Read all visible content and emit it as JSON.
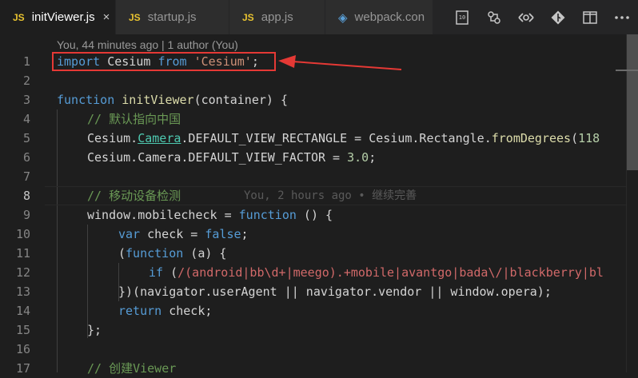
{
  "tabs": [
    {
      "icon": "JS",
      "label": "initViewer.js",
      "active": true,
      "close": "×"
    },
    {
      "icon": "JS",
      "label": "startup.js",
      "active": false
    },
    {
      "icon": "JS",
      "label": "app.js",
      "active": false
    },
    {
      "icon": "webpack",
      "label": "webpack.con",
      "active": false
    }
  ],
  "codelens": "You, 44 minutes ago | 1 author (You)",
  "blame_line8": "You, 2 hours ago • 继续完善",
  "line_numbers": [
    "1",
    "2",
    "3",
    "4",
    "5",
    "6",
    "7",
    "8",
    "9",
    "10",
    "11",
    "12",
    "13",
    "14",
    "15",
    "16",
    "17"
  ],
  "code": {
    "l1": {
      "kw1": "import",
      "id": " Cesium ",
      "kw2": "from",
      "str": "'Cesium'",
      "end": ";"
    },
    "l3": {
      "kw": "function",
      "fn": "initViewer",
      "rest": "(container) {"
    },
    "l4": {
      "cm": "// 默认指向中国"
    },
    "l5": {
      "a": "Cesium.",
      "link": "Camera",
      "b": ".DEFAULT_VIEW_RECTANGLE = Cesium.Rectangle.",
      "fn": "fromDegrees",
      "c": "(",
      "num": "118"
    },
    "l6": {
      "a": "Cesium.Camera.DEFAULT_VIEW_FACTOR = ",
      "num": "3.0",
      "b": ";"
    },
    "l8": {
      "cm": "// 移动设备检测"
    },
    "l9": {
      "a": "window.mobilecheck = ",
      "kw": "function",
      "b": " () {"
    },
    "l10": {
      "kw": "var",
      "a": " check = ",
      "kw2": "false",
      "b": ";"
    },
    "l11": {
      "a": "(",
      "kw": "function",
      "b": " (a) {"
    },
    "l12": {
      "kw": "if",
      "a": " (",
      "rx": "/(android|bb\\d+|meego).+mobile|avantgo|bada\\/|blackberry|bl"
    },
    "l13": {
      "a": "})(navigator.userAgent || navigator.vendor || window.opera);"
    },
    "l14": {
      "kw": "return",
      "a": " check;"
    },
    "l15": {
      "a": "};"
    },
    "l17": {
      "cm": "// 创建Viewer"
    }
  },
  "icons": [
    "split-diff-icon",
    "open-changes-icon",
    "compare-icon",
    "git-commit-icon",
    "split-editor-icon",
    "more-icon"
  ]
}
